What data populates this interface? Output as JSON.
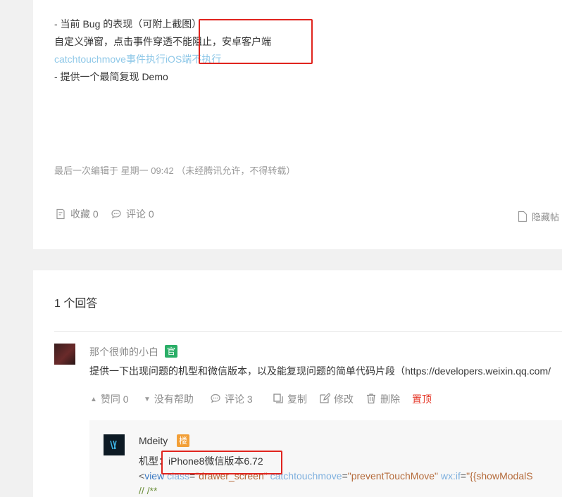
{
  "post": {
    "lines": [
      "- 当前 Bug 的表现（可附上截图）",
      "自定义弹窗，点击事件穿透不能阻止，安卓客户端",
      "catchtouchmove事件执行iOS端不执行",
      "- 提供一个最简复现 Demo"
    ],
    "edited": "最后一次编辑于  星期一 09:42  （未经腾讯允许，不得转载）",
    "actions": {
      "favorite": "收藏 0",
      "comment": "评论 0",
      "hide": "隐藏帖"
    }
  },
  "answers": {
    "count_label": "1 个回答",
    "answer": {
      "author": "那个很帅的小白",
      "badge": "官",
      "text": "提供一下出现问题的机型和微信版本，以及能复现问题的简单代码片段（https://developers.weixin.qq.com/",
      "toolbar": {
        "like": "赞同 0",
        "unhelpful": "没有帮助",
        "comment": "评论 3",
        "copy": "复制",
        "edit": "修改",
        "delete": "删除",
        "pin": "置顶"
      }
    },
    "reply": {
      "author": "Mdeity",
      "badge": "楼",
      "model_prefix": "机型：",
      "model_value": "iPhone8微信版本6.72",
      "code": {
        "open": "<",
        "tag": "view",
        "class_attr": "class",
        "class_val": "\"drawer_screen\"",
        "touch_attr": "catchtouchmove",
        "touch_val": "\"preventTouchMove\"",
        "if_attr": "wx:if",
        "if_val": "\"{{showModalS",
        "eq": "="
      },
      "comment_line": "// /**"
    }
  },
  "colors": {
    "highlight_box": "#e0241e",
    "link": "#8fc8e8",
    "official_badge": "#2aae67",
    "floor_badge": "#f29f37",
    "pin": "#e53b2c"
  }
}
